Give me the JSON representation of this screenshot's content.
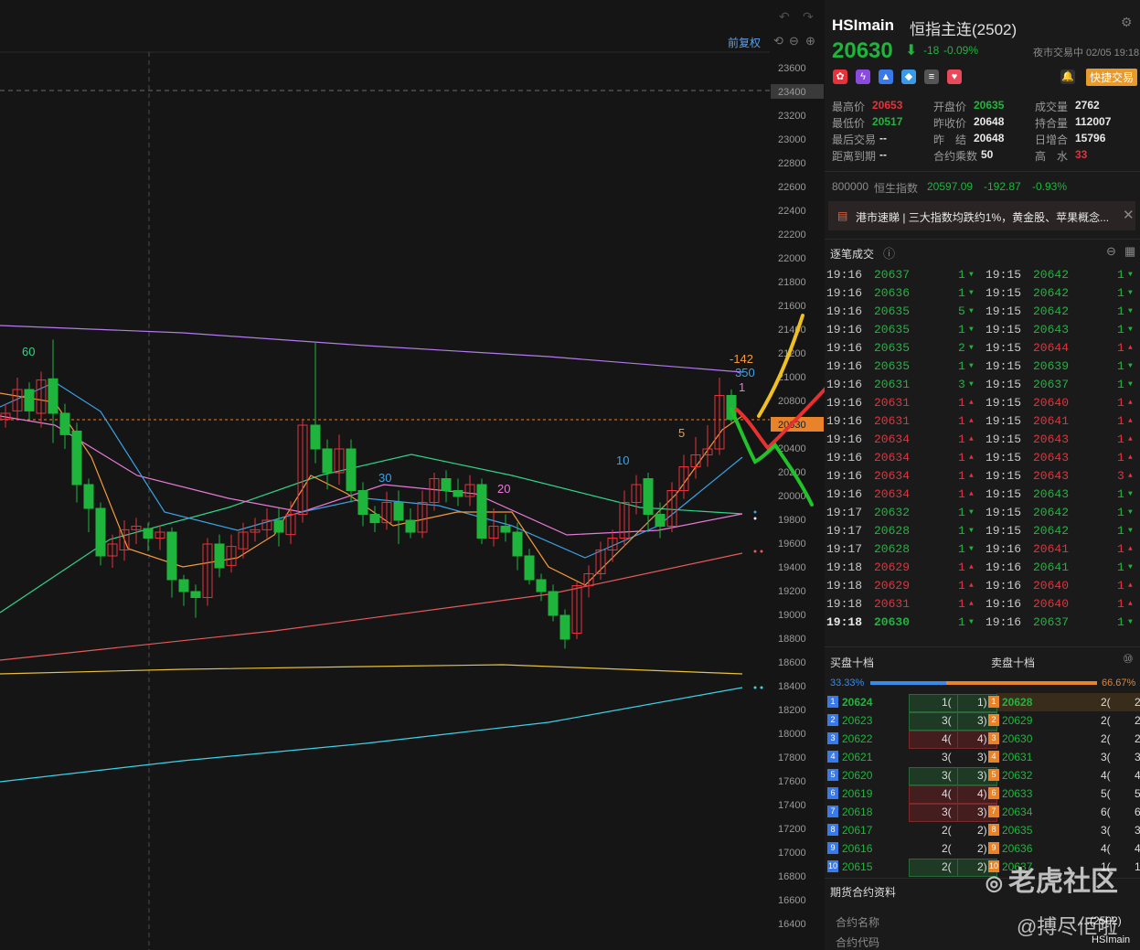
{
  "chart": {
    "adjust_label": "前复权",
    "y_ticks": [
      "23600",
      "23400",
      "23200",
      "23000",
      "22800",
      "22600",
      "22400",
      "22200",
      "22000",
      "21800",
      "21600",
      "21400",
      "21200",
      "21000",
      "20800",
      "20630",
      "20400",
      "20200",
      "20000",
      "19800",
      "19600",
      "19400",
      "19200",
      "19000",
      "18800",
      "18600",
      "18400",
      "18200",
      "18000",
      "17800",
      "17600",
      "17400",
      "17200",
      "17000",
      "16800",
      "16600",
      "16400"
    ],
    "current_price_tag": "20630",
    "highlight_tick": "23400",
    "ma_labels": {
      "ma60": "60",
      "ma30": "30",
      "ma20": "20",
      "ma10": "10",
      "ma5": "5"
    },
    "ann_neg": "-142",
    "ann_350": "350",
    "ann_1": "1",
    "colors": {
      "up": "#e8313a",
      "down": "#1fb53c",
      "ma5": "#f39a3c",
      "ma10": "#3aa3e8",
      "ma20": "#e87ad8",
      "ma30": "#2fd48a",
      "ma60": "#b57af0"
    }
  },
  "header": {
    "symbol": "HSImain",
    "name": "恒指主连(2502)",
    "price": "20630",
    "arrow": "⬇",
    "change": "-18",
    "change_pct": "-0.09%",
    "session": "夜市交易中 02/05 19:18",
    "quick_trade": "快捷交易"
  },
  "stats": [
    {
      "label": "最高价",
      "value": "20653",
      "color": "red"
    },
    {
      "label": "开盘价",
      "value": "20635",
      "color": "green"
    },
    {
      "label": "成交量",
      "value": "2762",
      "color": "white"
    },
    {
      "label": "最低价",
      "value": "20517",
      "color": "green"
    },
    {
      "label": "昨收价",
      "value": "20648",
      "color": "white"
    },
    {
      "label": "持合量",
      "value": "112007",
      "color": "white"
    },
    {
      "label": "最后交易",
      "value": "--",
      "color": "white"
    },
    {
      "label": "昨　结",
      "value": "20648",
      "color": "white"
    },
    {
      "label": "日增合",
      "value": "15796",
      "color": "white"
    },
    {
      "label": "距离到期",
      "value": "--",
      "color": "white"
    },
    {
      "label": "合约乘数",
      "value": "50",
      "color": "white"
    },
    {
      "label": "高　水",
      "value": "33",
      "color": "red"
    }
  ],
  "index": {
    "code": "800000",
    "name": "恒生指数",
    "value": "20597.09",
    "change": "-192.87",
    "pct": "-0.93%"
  },
  "news": {
    "text": "港市速睇 | 三大指数均跌约1%，黄金股、苹果概念..."
  },
  "ticks_title": "逐笔成交",
  "ticks_left": [
    {
      "t": "19:16",
      "p": "20637",
      "q": "1",
      "d": "down"
    },
    {
      "t": "19:16",
      "p": "20636",
      "q": "1",
      "d": "down"
    },
    {
      "t": "19:16",
      "p": "20635",
      "q": "5",
      "d": "down"
    },
    {
      "t": "19:16",
      "p": "20635",
      "q": "1",
      "d": "down"
    },
    {
      "t": "19:16",
      "p": "20635",
      "q": "2",
      "d": "down"
    },
    {
      "t": "19:16",
      "p": "20635",
      "q": "1",
      "d": "down"
    },
    {
      "t": "19:16",
      "p": "20631",
      "q": "3",
      "d": "down"
    },
    {
      "t": "19:16",
      "p": "20631",
      "q": "1",
      "d": "up"
    },
    {
      "t": "19:16",
      "p": "20631",
      "q": "1",
      "d": "up"
    },
    {
      "t": "19:16",
      "p": "20634",
      "q": "1",
      "d": "up"
    },
    {
      "t": "19:16",
      "p": "20634",
      "q": "1",
      "d": "up"
    },
    {
      "t": "19:16",
      "p": "20634",
      "q": "1",
      "d": "up"
    },
    {
      "t": "19:16",
      "p": "20634",
      "q": "1",
      "d": "up"
    },
    {
      "t": "19:17",
      "p": "20632",
      "q": "1",
      "d": "down"
    },
    {
      "t": "19:17",
      "p": "20628",
      "q": "1",
      "d": "down"
    },
    {
      "t": "19:17",
      "p": "20628",
      "q": "1",
      "d": "down"
    },
    {
      "t": "19:18",
      "p": "20629",
      "q": "1",
      "d": "up"
    },
    {
      "t": "19:18",
      "p": "20629",
      "q": "1",
      "d": "up"
    },
    {
      "t": "19:18",
      "p": "20631",
      "q": "1",
      "d": "up"
    },
    {
      "t": "19:18",
      "p": "20630",
      "q": "1",
      "d": "down"
    }
  ],
  "ticks_right": [
    {
      "t": "19:15",
      "p": "20642",
      "q": "1",
      "d": "down"
    },
    {
      "t": "19:15",
      "p": "20642",
      "q": "1",
      "d": "down"
    },
    {
      "t": "19:15",
      "p": "20642",
      "q": "1",
      "d": "down"
    },
    {
      "t": "19:15",
      "p": "20643",
      "q": "1",
      "d": "down"
    },
    {
      "t": "19:15",
      "p": "20644",
      "q": "1",
      "d": "up"
    },
    {
      "t": "19:15",
      "p": "20639",
      "q": "1",
      "d": "down"
    },
    {
      "t": "19:15",
      "p": "20637",
      "q": "1",
      "d": "down"
    },
    {
      "t": "19:15",
      "p": "20640",
      "q": "1",
      "d": "up"
    },
    {
      "t": "19:15",
      "p": "20641",
      "q": "1",
      "d": "up"
    },
    {
      "t": "19:15",
      "p": "20643",
      "q": "1",
      "d": "up"
    },
    {
      "t": "19:15",
      "p": "20643",
      "q": "1",
      "d": "up"
    },
    {
      "t": "19:15",
      "p": "20643",
      "q": "3",
      "d": "up"
    },
    {
      "t": "19:15",
      "p": "20643",
      "q": "1",
      "d": "down"
    },
    {
      "t": "19:15",
      "p": "20642",
      "q": "1",
      "d": "down"
    },
    {
      "t": "19:15",
      "p": "20642",
      "q": "1",
      "d": "down"
    },
    {
      "t": "19:16",
      "p": "20641",
      "q": "1",
      "d": "up"
    },
    {
      "t": "19:16",
      "p": "20641",
      "q": "1",
      "d": "down"
    },
    {
      "t": "19:16",
      "p": "20640",
      "q": "1",
      "d": "up"
    },
    {
      "t": "19:16",
      "p": "20640",
      "q": "1",
      "d": "up"
    },
    {
      "t": "19:16",
      "p": "20637",
      "q": "1",
      "d": "down"
    }
  ],
  "book": {
    "bid_title": "买盘十档",
    "ask_title": "卖盘十档",
    "bid_pct": "33.33%",
    "ask_pct": "66.67%",
    "bid_ratio": 0.3333,
    "bids": [
      {
        "n": "1",
        "p": "20624",
        "q": "1(",
        "q2": "1)"
      },
      {
        "n": "2",
        "p": "20623",
        "q": "3(",
        "q2": "3)"
      },
      {
        "n": "3",
        "p": "20622",
        "q": "4(",
        "q2": "4)"
      },
      {
        "n": "4",
        "p": "20621",
        "q": "3(",
        "q2": "3)"
      },
      {
        "n": "5",
        "p": "20620",
        "q": "3(",
        "q2": "3)"
      },
      {
        "n": "6",
        "p": "20619",
        "q": "4(",
        "q2": "4)"
      },
      {
        "n": "7",
        "p": "20618",
        "q": "3(",
        "q2": "3)"
      },
      {
        "n": "8",
        "p": "20617",
        "q": "2(",
        "q2": "2)"
      },
      {
        "n": "9",
        "p": "20616",
        "q": "2(",
        "q2": "2)"
      },
      {
        "n": "10",
        "p": "20615",
        "q": "2(",
        "q2": "2)"
      }
    ],
    "asks": [
      {
        "n": "1",
        "p": "20628",
        "q": "2(",
        "q2": "2"
      },
      {
        "n": "2",
        "p": "20629",
        "q": "2(",
        "q2": "2"
      },
      {
        "n": "3",
        "p": "20630",
        "q": "2(",
        "q2": "2"
      },
      {
        "n": "4",
        "p": "20631",
        "q": "3(",
        "q2": "3"
      },
      {
        "n": "5",
        "p": "20632",
        "q": "4(",
        "q2": "4"
      },
      {
        "n": "6",
        "p": "20633",
        "q": "5(",
        "q2": "5"
      },
      {
        "n": "7",
        "p": "20634",
        "q": "6(",
        "q2": "6"
      },
      {
        "n": "8",
        "p": "20635",
        "q": "3(",
        "q2": "3"
      },
      {
        "n": "9",
        "p": "20636",
        "q": "4(",
        "q2": "4"
      },
      {
        "n": "10",
        "p": "20637",
        "q": "1(",
        "q2": "1"
      }
    ]
  },
  "contract": {
    "title": "期货合约资料",
    "name_label": "合约名称",
    "code_label": "合约代码",
    "name_value": "...(2502)",
    "code_value": "HSImain"
  },
  "watermark": {
    "brand": "老虎社区",
    "user": "@搏尽佢啦"
  }
}
